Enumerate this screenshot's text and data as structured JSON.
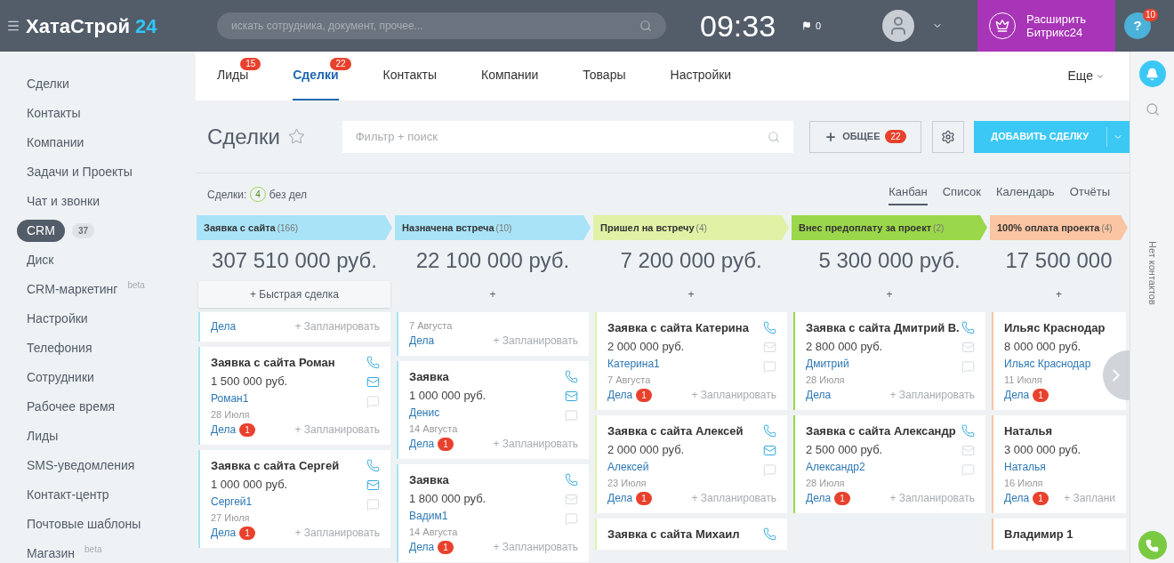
{
  "header": {
    "logo": {
      "name": "ХатаСтрой",
      "suffix": "24"
    },
    "search": {
      "placeholder": "искать сотрудника, документ, прочее..."
    },
    "clock": "09:33",
    "flag_count": "0",
    "upgrade": {
      "line_1": "Расширить",
      "line_2": "Битрикс24"
    }
  },
  "right_panel": {
    "help": "?",
    "help_badge": "10",
    "contacts_label": "Нет контактов"
  },
  "sidebar": {
    "items": [
      {
        "label": "Сделки",
        "selected": false
      },
      {
        "label": "Контакты",
        "selected": false
      },
      {
        "label": "Компании",
        "selected": false
      },
      {
        "label": "Задачи и Проекты",
        "selected": false
      },
      {
        "label": "Чат и звонки",
        "selected": false
      },
      {
        "label": "CRM",
        "selected": true,
        "counter": "37"
      },
      {
        "label": "Диск",
        "selected": false
      },
      {
        "label": "CRM-маркетинг",
        "selected": false,
        "tag": "beta"
      },
      {
        "label": "Настройки",
        "selected": false
      },
      {
        "label": "Телефония",
        "selected": false
      },
      {
        "label": "Сотрудники",
        "selected": false
      },
      {
        "label": "Рабочее время",
        "selected": false
      },
      {
        "label": "Лиды",
        "selected": false
      },
      {
        "label": "SMS-уведомления",
        "selected": false
      },
      {
        "label": "Контакт-центр",
        "selected": false
      },
      {
        "label": "Почтовые шаблоны",
        "selected": false
      },
      {
        "label": "Магазин",
        "selected": false,
        "tag": "beta"
      }
    ]
  },
  "tabs": [
    {
      "label": "Лиды",
      "badge": "15",
      "selected": false
    },
    {
      "label": "Сделки",
      "badge": "22",
      "selected": true
    },
    {
      "label": "Контакты",
      "selected": false
    },
    {
      "label": "Компании",
      "selected": false
    },
    {
      "label": "Товары",
      "selected": false
    },
    {
      "label": "Настройки",
      "selected": false
    }
  ],
  "more": "Еще",
  "toolbar": {
    "title": "Сделки",
    "filter": {
      "placeholder": "Фильтр + поиск"
    },
    "category": {
      "label": "ОБЩЕЕ",
      "count": "22"
    },
    "add": "ДОБАВИТЬ СДЕЛКУ"
  },
  "summary": {
    "label": "Сделки:",
    "count": "4",
    "suffix": "без дел"
  },
  "views": [
    {
      "label": "Канбан",
      "selected": true
    },
    {
      "label": "Список",
      "selected": false
    },
    {
      "label": "Календарь",
      "selected": false
    },
    {
      "label": "Отчёты",
      "selected": false
    }
  ],
  "columns": [
    {
      "name": "Заявка с сайта",
      "count": "(166)",
      "color": "#a9e3f7",
      "total": "307 510 000 руб.",
      "add": "+ Быстрая сделка",
      "cards": [
        {
          "activities": "Дела",
          "schedule": "+ Запланировать"
        },
        {
          "title": "Заявка с сайта Роман",
          "amount": "1 500 000 руб.",
          "contact": "Роман1",
          "date": "28 Июля",
          "activities": "Дела",
          "activity_count": "1",
          "schedule": "+ Запланировать",
          "icons": [
            {
              "kind": "phone",
              "active": true
            },
            {
              "kind": "mail",
              "active": true
            },
            {
              "kind": "chat",
              "active": false
            }
          ]
        },
        {
          "title": "Заявка с сайта Сергей",
          "amount": "1 000 000 руб.",
          "contact": "Сергей1",
          "date": "27 Июля",
          "activities": "Дела",
          "activity_count": "1",
          "schedule": "+ Запланировать",
          "icons": [
            {
              "kind": "phone",
              "active": true
            },
            {
              "kind": "mail",
              "active": true
            },
            {
              "kind": "chat",
              "active": false
            }
          ]
        }
      ]
    },
    {
      "name": "Назначена встреча",
      "count": "(10)",
      "color": "#a9e3f7",
      "total": "22 100 000 руб.",
      "add": "+",
      "cards": [
        {
          "date": "7 Августа",
          "activities": "Дела",
          "schedule": "+ Запланировать"
        },
        {
          "title": "Заявка",
          "amount": "1 000 000 руб.",
          "contact": "Денис",
          "date": "14 Августа",
          "activities": "Дела",
          "activity_count": "1",
          "schedule": "+ Запланировать",
          "icons": [
            {
              "kind": "phone",
              "active": true
            },
            {
              "kind": "mail",
              "active": true
            },
            {
              "kind": "chat",
              "active": false
            }
          ]
        },
        {
          "title": "Заявка",
          "amount": "1 800 000 руб.",
          "contact": "Вадим1",
          "date": "14 Августа",
          "activities": "Дела",
          "activity_count": "1",
          "schedule": "+ Запланировать",
          "icons": [
            {
              "kind": "phone",
              "active": true
            },
            {
              "kind": "mail",
              "active": false
            },
            {
              "kind": "chat",
              "active": false
            }
          ]
        }
      ]
    },
    {
      "name": "Пришел на встречу",
      "count": "(4)",
      "color": "#e0f2a6",
      "total": "7 200 000 руб.",
      "add": "+",
      "cards": [
        {
          "title": "Заявка с сайта Катерина",
          "amount": "2 000 000 руб.",
          "contact": "Катерина1",
          "date": "7 Августа",
          "activities": "Дела",
          "activity_count": "1",
          "schedule": "+ Запланировать",
          "icons": [
            {
              "kind": "phone",
              "active": true
            },
            {
              "kind": "mail",
              "active": false
            },
            {
              "kind": "chat",
              "active": false
            }
          ]
        },
        {
          "title": "Заявка с сайта Алексей",
          "amount": "2 000 000 руб.",
          "contact": "Алексей",
          "date": "23 Июля",
          "activities": "Дела",
          "activity_count": "1",
          "schedule": "+ Запланировать",
          "icons": [
            {
              "kind": "phone",
              "active": true
            },
            {
              "kind": "mail",
              "active": true
            },
            {
              "kind": "chat",
              "active": false
            }
          ]
        },
        {
          "title": "Заявка с сайта Михаил",
          "icons": [
            {
              "kind": "phone",
              "active": true
            }
          ]
        }
      ]
    },
    {
      "name": "Внес предоплату за проект",
      "count": "(2)",
      "color": "#9bd74a",
      "total": "5 300 000 руб.",
      "add": "+",
      "cards": [
        {
          "title": "Заявка с сайта Дмитрий В.",
          "amount": "2 800 000 руб.",
          "contact": "Дмитрий",
          "date": "28 Июля",
          "activities": "Дела",
          "schedule": "+ Запланировать",
          "icons": [
            {
              "kind": "phone",
              "active": true
            },
            {
              "kind": "mail",
              "active": false
            },
            {
              "kind": "chat",
              "active": false
            }
          ]
        },
        {
          "title": "Заявка с сайта Александр",
          "amount": "2 500 000 руб.",
          "contact": "Александр2",
          "date": "28 Июля",
          "activities": "Дела",
          "activity_count": "1",
          "schedule": "+ Запланировать",
          "icons": [
            {
              "kind": "phone",
              "active": true
            },
            {
              "kind": "mail",
              "active": false
            },
            {
              "kind": "chat",
              "active": false
            }
          ]
        }
      ]
    },
    {
      "name": "100% оплата проекта",
      "count": "(4)",
      "color": "#fbc4a2",
      "total": "17 500 000",
      "add": "+",
      "cards": [
        {
          "title": "Ильяс Краснодар",
          "amount": "8 000 000 руб.",
          "contact": "Ильяс Краснодар",
          "date": "11 Июля",
          "activities": "Дела",
          "activity_count": "1"
        },
        {
          "title": "Наталья",
          "amount": "3 000 000 руб.",
          "contact": "Наталья",
          "date": "16 Июля",
          "activities": "Дела",
          "activity_count": "1",
          "schedule": "+ Заплани"
        },
        {
          "title": "Владимир 1"
        }
      ]
    }
  ]
}
